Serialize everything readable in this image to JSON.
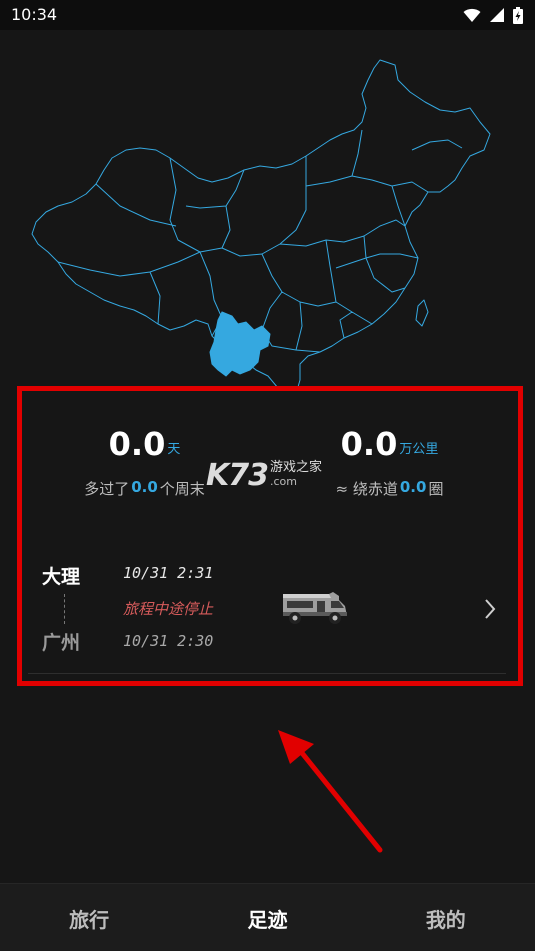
{
  "status_bar": {
    "time": "10:34",
    "icons": [
      "wifi-icon",
      "signal-icon",
      "battery-icon"
    ]
  },
  "map": {
    "highlighted_region": "Yunnan",
    "outline_color": "#35a8e0",
    "fill_color": "#35a8e0"
  },
  "stats": {
    "days": {
      "value": "0.0",
      "unit": "天",
      "sub_prefix": "多过了",
      "sub_value": "0.0",
      "sub_suffix": "个周末"
    },
    "distance": {
      "value": "0.0",
      "unit": "万公里",
      "sub_prefix": "≈ 绕赤道",
      "sub_value": "0.0",
      "sub_suffix": "圈"
    }
  },
  "watermark": {
    "logo": "K73",
    "text": "游戏之家",
    "domain": ".com"
  },
  "trip": {
    "from_city": "大理",
    "to_city": "广州",
    "start_time": "10/31 2:31",
    "status": "旅程中途停止",
    "end_time": "10/31 2:30",
    "vehicle_icon": "rv-icon"
  },
  "bottom_nav": {
    "tabs": [
      {
        "label": "旅行",
        "active": false
      },
      {
        "label": "足迹",
        "active": true
      },
      {
        "label": "我的",
        "active": false
      }
    ]
  },
  "colors": {
    "accent": "#35a8e0",
    "annotation": "#e10000",
    "status_stopped": "#d65b5b",
    "background": "#161616"
  }
}
